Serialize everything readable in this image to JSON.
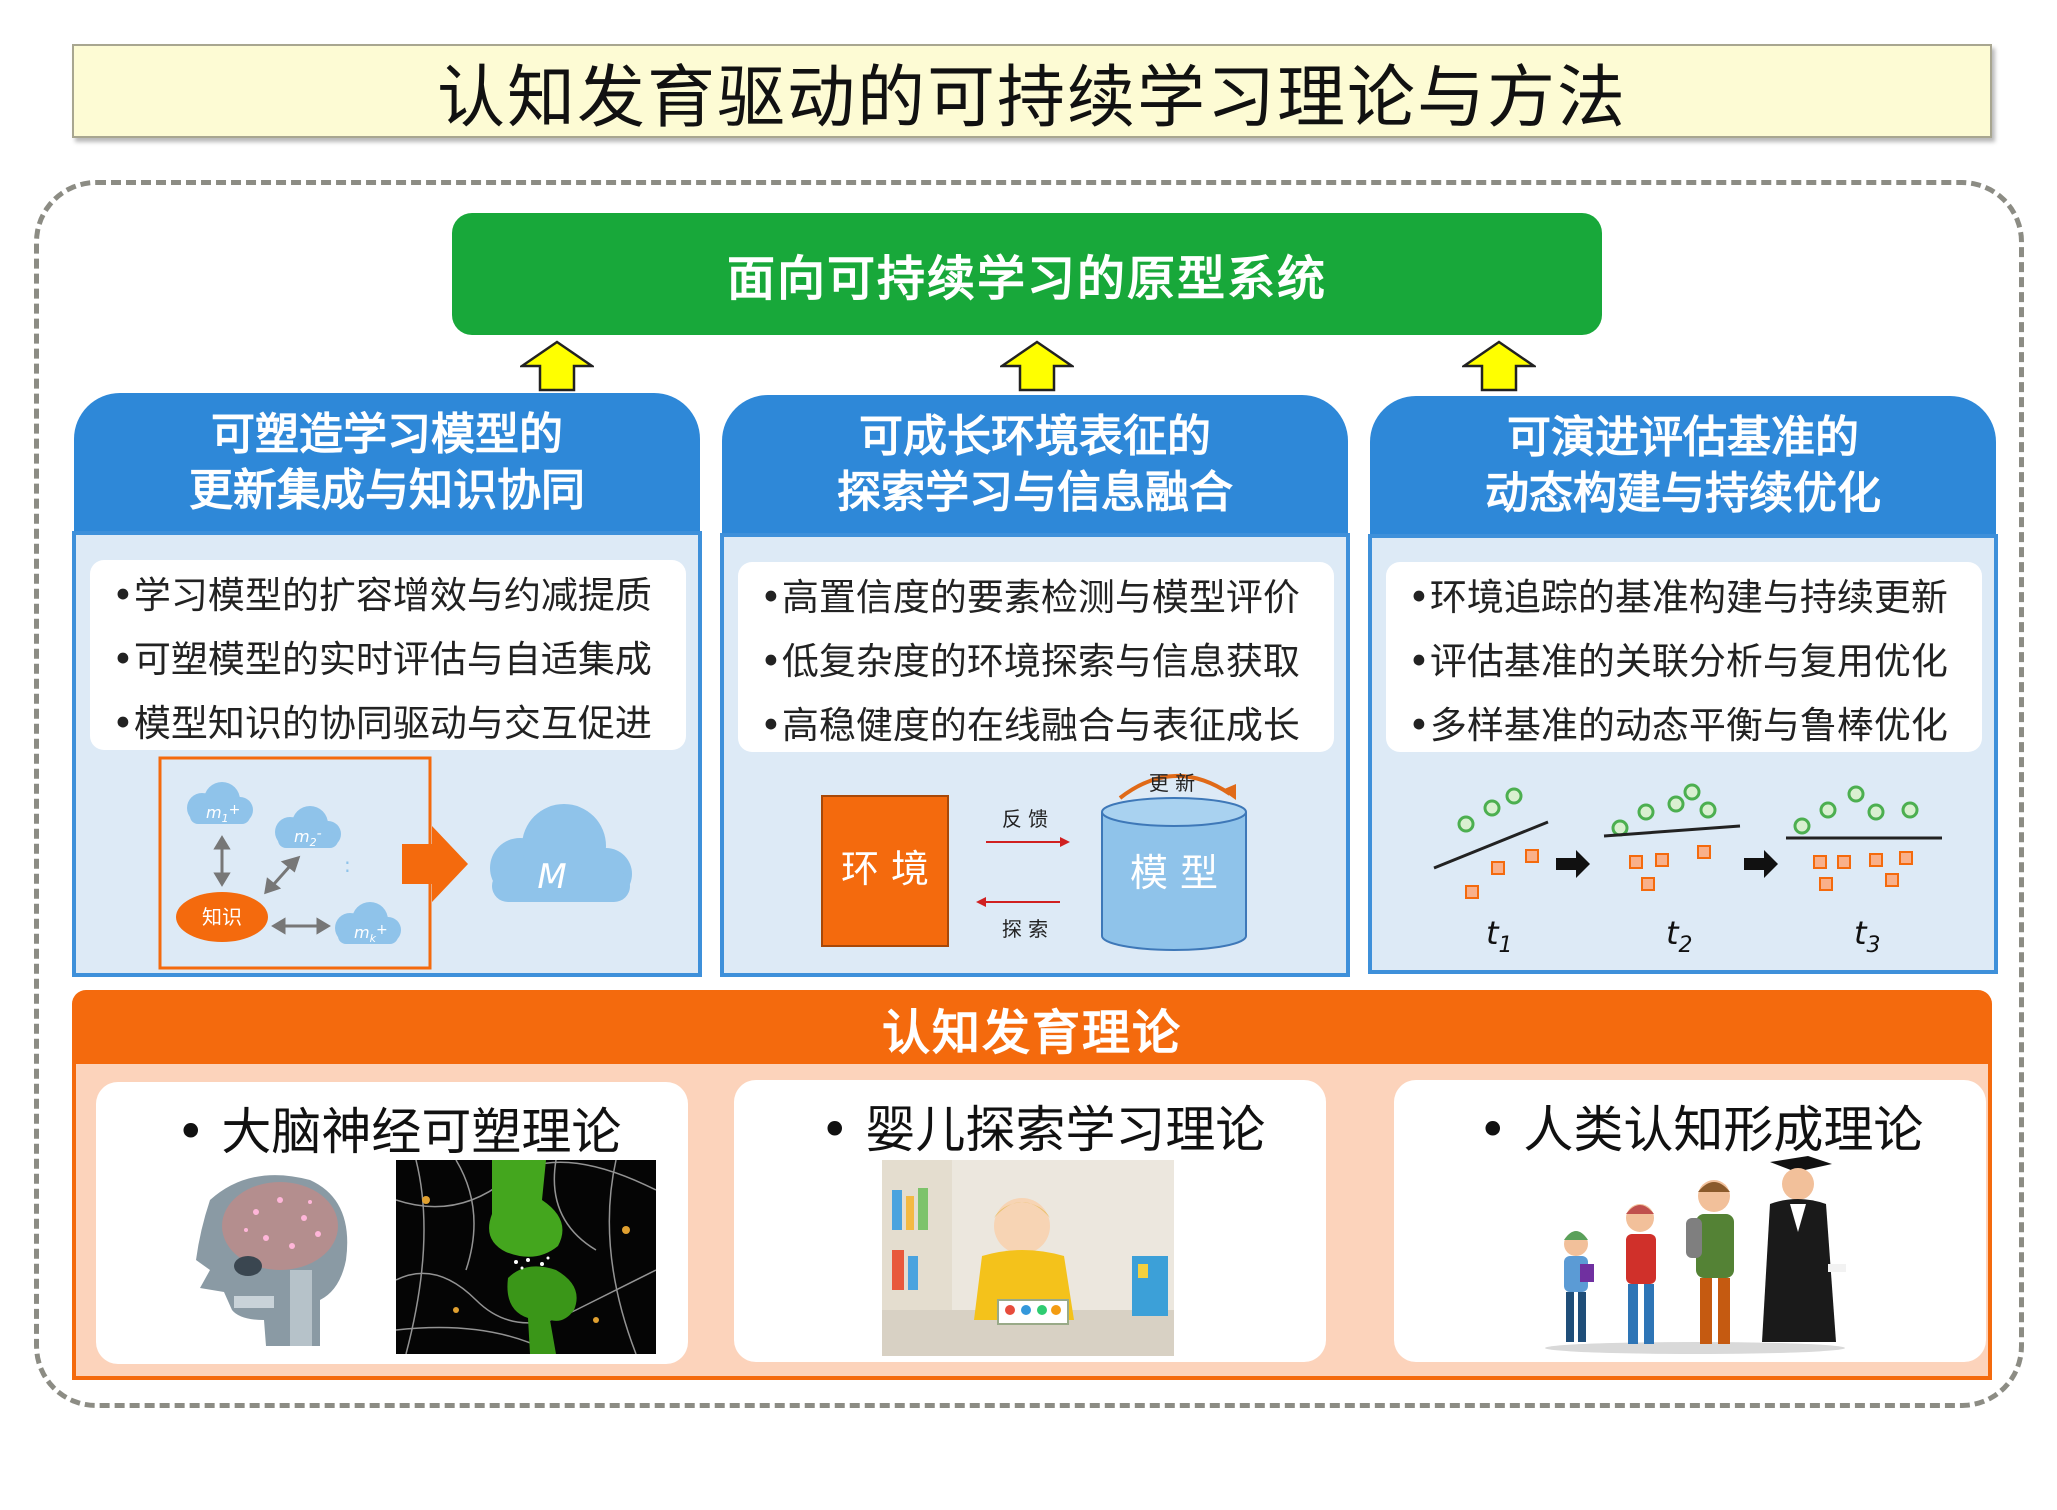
{
  "title": "认知发育驱动的可持续学习理论与方法",
  "prototype": "面向可持续学习的原型系统",
  "panels": [
    {
      "title_line1": "可塑造学习模型的",
      "title_line2": "更新集成与知识协同",
      "bullets": [
        "•学习模型的扩容增效与约减提质",
        "•可塑模型的实时评估与自适集成",
        "•模型知识的协同驱动与交互促进"
      ],
      "diagram": {
        "m1": "m",
        "m1_sub": "1",
        "m1_sign": "+",
        "m2": "m",
        "m2_sub": "2",
        "m2_sign": "-",
        "mk": "m",
        "mk_sub": "k",
        "mk_sign": "+",
        "knowledge": "知识",
        "M": "M"
      }
    },
    {
      "title_line1": "可成长环境表征的",
      "title_line2": "探索学习与信息融合",
      "bullets": [
        "•高置信度的要素检测与模型评价",
        "•低复杂度的环境探索与信息获取",
        "•高稳健度的在线融合与表征成长"
      ],
      "diagram": {
        "env": "环 境",
        "model": "模 型",
        "update": "更 新",
        "feedback": "反 馈",
        "explore": "探 索"
      }
    },
    {
      "title_line1": "可演进评估基准的",
      "title_line2": "动态构建与持续优化",
      "bullets": [
        "•环境追踪的基准构建与持续更新",
        "•评估基准的关联分析与复用优化",
        "•多样基准的动态平衡与鲁棒优化"
      ],
      "diagram": {
        "t": "t",
        "t1_sub": "1",
        "t2_sub": "2",
        "t3_sub": "3"
      }
    }
  ],
  "theory": {
    "title": "认知发育理论",
    "items": [
      "•  大脑神经可塑理论",
      "•  婴儿探索学习理论",
      "•  人类认知形成理论"
    ]
  },
  "colors": {
    "green": "#18a83a",
    "blue": "#2e88d8",
    "orange": "#f46a0d",
    "arrow_yellow": "#ffff00",
    "title_bg": "#fdfbd4"
  }
}
